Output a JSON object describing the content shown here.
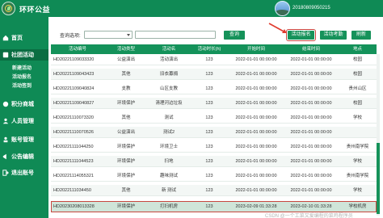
{
  "header": {
    "app_title": "环环公益",
    "user_id": "20180809050215"
  },
  "sidebar": {
    "items": [
      {
        "label": "首页",
        "icon": "home-icon"
      },
      {
        "label": "社团活动",
        "icon": "activity-icon",
        "active": true
      },
      {
        "label": "积分商城",
        "icon": "shop-icon"
      },
      {
        "label": "人员管理",
        "icon": "people-icon"
      },
      {
        "label": "账号管理",
        "icon": "account-icon"
      },
      {
        "label": "公告编辑",
        "icon": "notice-icon"
      },
      {
        "label": "退出账号",
        "icon": "logout-icon"
      }
    ],
    "sub_items": [
      {
        "label": "新建活动"
      },
      {
        "label": "活动报名"
      },
      {
        "label": "活动签到"
      }
    ]
  },
  "toolbar": {
    "query_label": "查询选项:",
    "select_value": "",
    "input_value": "",
    "search_label": "查询",
    "signup_label": "活动报名",
    "checkin_label": "活动考勤",
    "refresh_label": "刷新"
  },
  "table": {
    "headers": [
      "活动编号",
      "活动类型",
      "活动名",
      "活动时长(h)",
      "开始时间",
      "结束时间",
      "地点"
    ],
    "rows": [
      [
        "HD20221109033320",
        "公益演出",
        "活动演出",
        "123",
        "2022-01-01 00:00:00",
        "2022-01-01 00:00:00",
        "校园"
      ],
      [
        "HD20221109043423",
        "其他",
        "旧衣募捐",
        "123",
        "2022-01-01 00:00:00",
        "2022-01-01 00:00:00",
        "校园"
      ],
      [
        "HD20221109040824",
        "支教",
        "山区支教",
        "123",
        "2022-01-01 00:00:00",
        "2022-01-01 00:00:00",
        "贵州山区"
      ],
      [
        "HD20221109040827",
        "环境保护",
        "清理河边垃圾",
        "123",
        "2022-01-01 00:00:00",
        "2022-01-01 00:00:00",
        "校园"
      ],
      [
        "HD20221110073320",
        "其他",
        "测试",
        "123",
        "2022-01-01 00:00:00",
        "2022-01-01 00:00:00",
        "学校"
      ],
      [
        "HD20221110070526",
        "公益演出",
        "测试2",
        "123",
        "2022-01-01 00:00:00",
        "2022-01-01 00:00:00",
        ""
      ],
      [
        "HD20221111044250",
        "环境保护",
        "环境卫士",
        "123",
        "2022-01-01 00:00:00",
        "2022-01-01 00:00:00",
        "贵州南学院"
      ],
      [
        "HD20221111044523",
        "环境保护",
        "扫地",
        "123",
        "2022-01-01 00:00:00",
        "2022-01-01 00:00:00",
        "学校"
      ],
      [
        "HD20221114055321",
        "环境保护",
        "趣味测试",
        "123",
        "2022-01-01 00:00:00",
        "2022-01-01 00:00:00",
        "贵州南学院"
      ],
      [
        "HD2022111034450",
        "其他",
        "新 测试",
        "123",
        "2022-01-01 00:00:00",
        "2022-01-01 00:00:00",
        "学校"
      ],
      [
        "HD20230208013328",
        "环境保护",
        "打扫机房",
        "123",
        "2023-02-09 01:33:28",
        "2023-02-10 01:33:28",
        "学校机房"
      ]
    ]
  },
  "watermark": "CSDN @一个工菜又爱编程的菜鸡程序员",
  "colors": {
    "brand_green": "#0f8a55",
    "highlight_red": "#c8473f"
  }
}
